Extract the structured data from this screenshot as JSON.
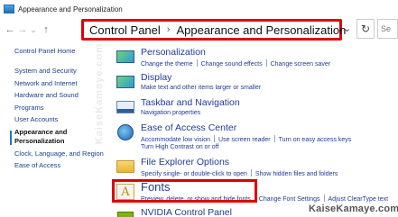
{
  "window": {
    "title": "Appearance and Personalization"
  },
  "nav": {
    "back": "←",
    "forward": "→",
    "recent": "⌄",
    "up": "↑"
  },
  "address": {
    "crumbs": [
      "Control Panel",
      "Appearance and Personalization"
    ],
    "separator": "›",
    "dropdown": "⌄",
    "refresh": "↻",
    "search_placeholder": "Se"
  },
  "sidebar": {
    "home": "Control Panel Home",
    "items": [
      "System and Security",
      "Network and Internet",
      "Hardware and Sound",
      "Programs",
      "User Accounts",
      "Appearance and Personalization",
      "Clock, Language, and Region",
      "Ease of Access"
    ],
    "current_index": 5
  },
  "watermark": "KaiseKamaye.com",
  "categories": [
    {
      "id": "personalization",
      "icon": "personalization-icon",
      "heading": "Personalization",
      "links": [
        "Change the theme",
        "Change sound effects",
        "Change screen saver"
      ],
      "links2": []
    },
    {
      "id": "display",
      "icon": "display-icon",
      "heading": "Display",
      "links": [
        "Make text and other items larger or smaller"
      ],
      "links2": []
    },
    {
      "id": "taskbar",
      "icon": "taskbar-icon",
      "heading": "Taskbar and Navigation",
      "links": [
        "Navigation properties"
      ],
      "links2": []
    },
    {
      "id": "ease",
      "icon": "ease-of-access-icon",
      "heading": "Ease of Access Center",
      "links": [
        "Accommodate low vision",
        "Use screen reader",
        "Turn on easy access keys"
      ],
      "links2": [
        "Turn High Contrast on or off"
      ]
    },
    {
      "id": "explorer",
      "icon": "folder-icon",
      "heading": "File Explorer Options",
      "links": [
        "Specify single- or double-click to open",
        "Show hidden files and folders"
      ],
      "links2": []
    },
    {
      "id": "fonts",
      "icon": "fonts-icon",
      "heading": "Fonts",
      "links": [
        "Preview, delete, or show and hide fonts",
        "Change Font Settings",
        "Adjust ClearType text"
      ],
      "links2": []
    },
    {
      "id": "nvidia",
      "icon": "nvidia-icon",
      "heading": "NVIDIA Control Panel",
      "links": [],
      "links2": []
    }
  ],
  "brand": "KaiseKamaye.com",
  "colors": {
    "highlight": "#e00000",
    "link": "#1e3c95",
    "nav_link": "#1a3e8f",
    "current_marker": "#1a73d8"
  }
}
